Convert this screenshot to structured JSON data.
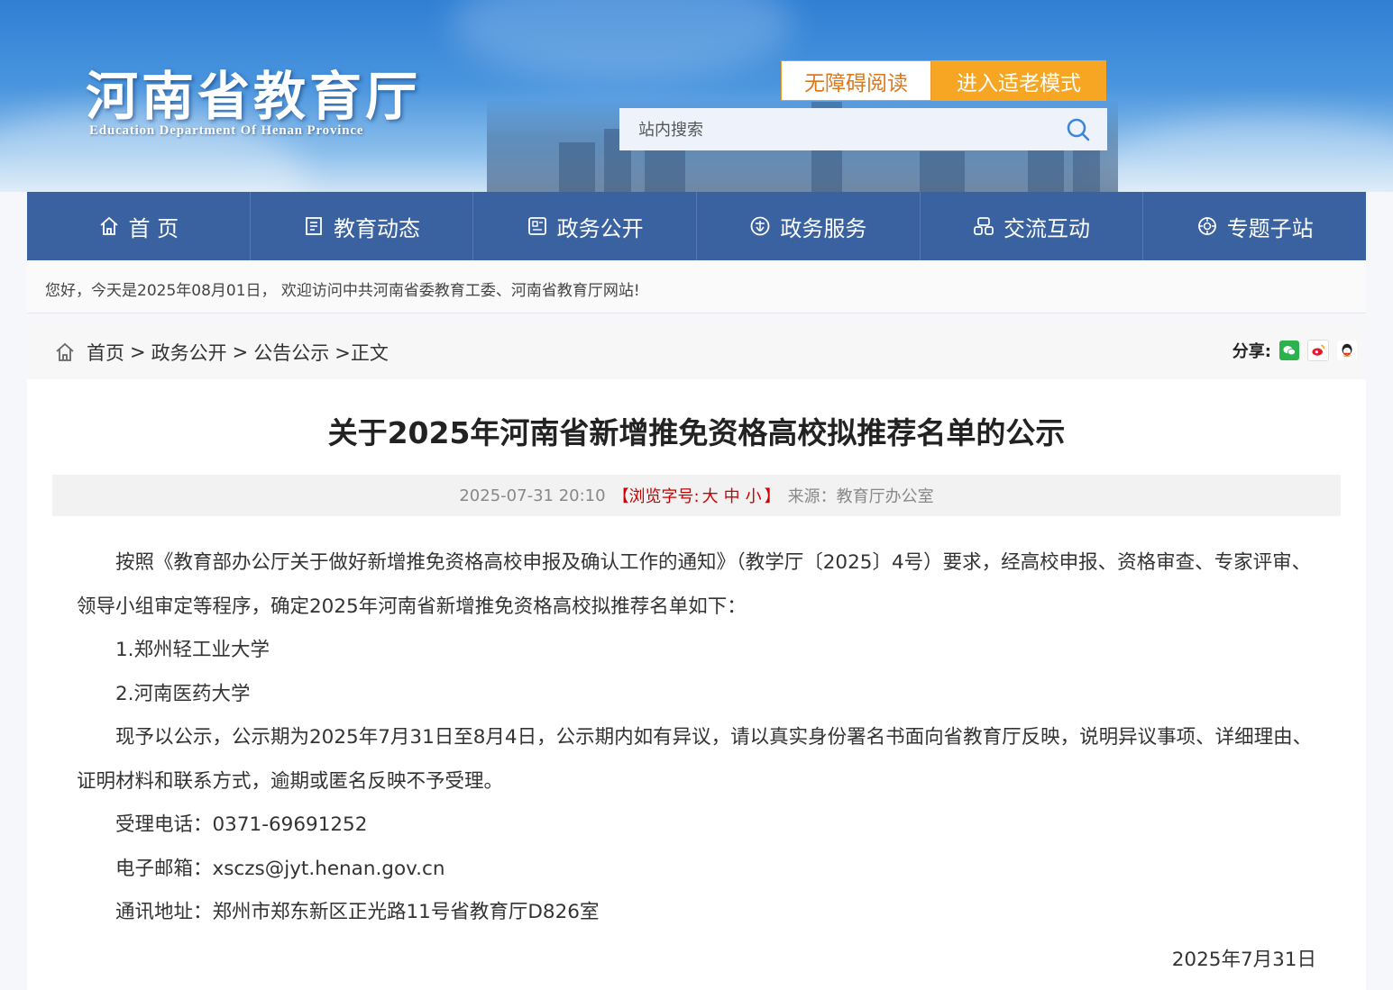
{
  "header": {
    "logo_cn": "河南省教育厅",
    "logo_en": "Education Department Of Henan Province",
    "accessibility_label": "无障碍阅读",
    "elder_mode_label": "进入适老模式",
    "search_placeholder": "站内搜索"
  },
  "nav": {
    "items": [
      {
        "label": "首 页",
        "icon": "home-icon"
      },
      {
        "label": "教育动态",
        "icon": "news-icon"
      },
      {
        "label": "政务公开",
        "icon": "document-icon"
      },
      {
        "label": "政务服务",
        "icon": "service-icon"
      },
      {
        "label": "交流互动",
        "icon": "interact-icon"
      },
      {
        "label": "专题子站",
        "icon": "topic-icon"
      }
    ]
  },
  "welcome_text": "您好，今天是2025年08月01日， 欢迎访问中共河南省委教育工委、河南省教育厅网站!",
  "breadcrumb": {
    "home": "首页",
    "sep1": ">",
    "level1": "政务公开",
    "sep2": ">",
    "level2": "公告公示",
    "current": ">正文"
  },
  "share": {
    "label": "分享:",
    "icons": [
      "wechat-icon",
      "weibo-icon",
      "qq-icon"
    ]
  },
  "article": {
    "title": "关于2025年河南省新增推免资格高校拟推荐名单的公示",
    "datetime": "2025-07-31 20:10",
    "fontsize_open": "【浏览字号:",
    "fontsize_large": "大",
    "fontsize_medium": "中",
    "fontsize_small": "小",
    "fontsize_close": "】",
    "source": "来源：教育厅办公室",
    "paragraphs": [
      "按照《教育部办公厅关于做好新增推免资格高校申报及确认工作的通知》（教学厅〔2025〕4号）要求，经高校申报、资格审查、专家评审、领导小组审定等程序，确定2025年河南省新增推免资格高校拟推荐名单如下：",
      "1.郑州轻工业大学",
      "2.河南医药大学",
      "现予以公示，公示期为2025年7月31日至8月4日，公示期内如有异议，请以真实身份署名书面向省教育厅反映，说明异议事项、详细理由、证明材料和联系方式，逾期或匿名反映不予受理。",
      "受理电话：0371-69691252",
      "电子邮箱：xsczs@jyt.henan.gov.cn",
      "通讯地址：郑州市郑东新区正光路11号省教育厅D826室"
    ],
    "sign_date": "2025年7月31日"
  },
  "colors": {
    "nav_bg": "#3a62a0",
    "accent_orange": "#f6a623",
    "red": "#cc0000"
  }
}
